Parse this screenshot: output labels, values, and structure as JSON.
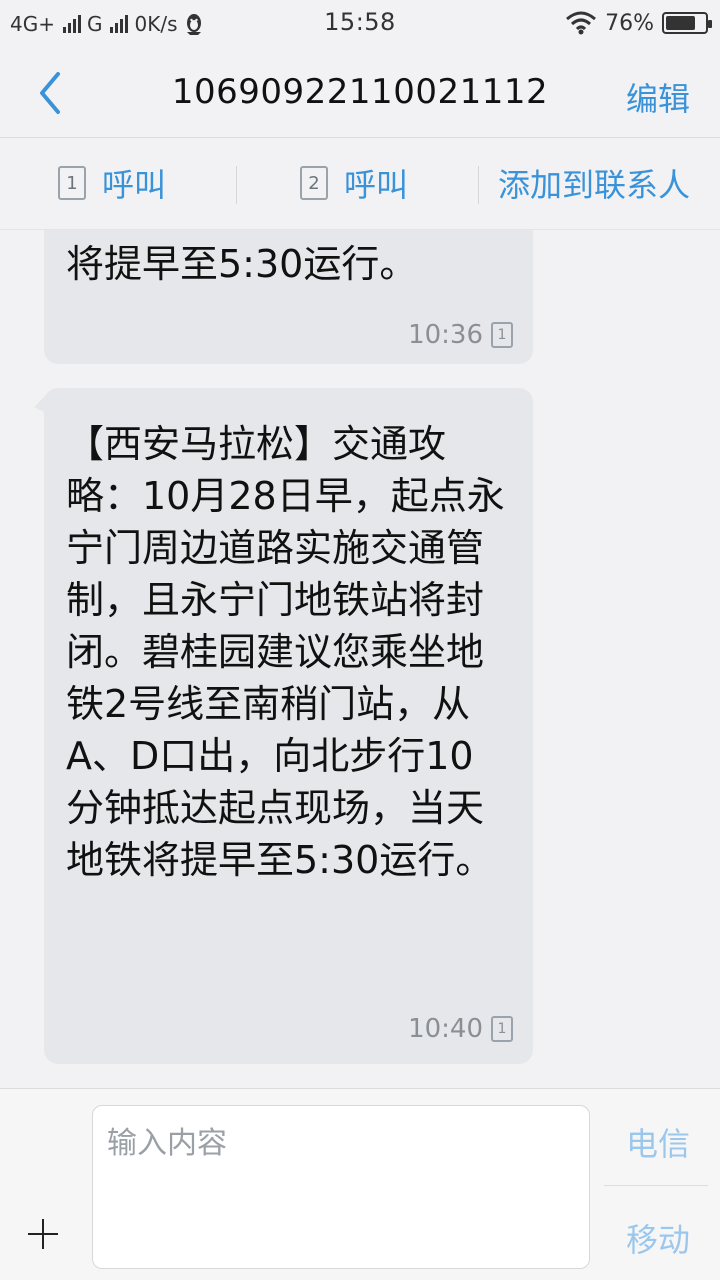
{
  "status_bar": {
    "left_network_1": "4G+",
    "left_network_2": "G",
    "left_speed": "0K/s",
    "time": "15:58",
    "battery_text": "76%",
    "battery_level": 0.76
  },
  "header": {
    "title": "10690922110021112",
    "edit_label": "编辑"
  },
  "actions": {
    "call_sim1_label": "呼叫",
    "call_sim2_label": "呼叫",
    "add_contact_label": "添加到联系人",
    "sim1_badge": "1",
    "sim2_badge": "2"
  },
  "messages": [
    {
      "text": "将提早至5:30运行。",
      "time": "10:36",
      "sim_badge": "1"
    },
    {
      "text": "【西安马拉松】交通攻略：10月28日早，起点永宁门周边道路实施交通管制，且永宁门地铁站将封闭。碧桂园建议您乘坐地铁2号线至南稍门站，从A、D口出，向北步行10分钟抵达起点现场，当天地铁将提早至5:30运行。",
      "time": "10:40",
      "sim_badge": "1"
    }
  ],
  "composer": {
    "placeholder": "输入内容",
    "send_option_1": "电信",
    "send_option_2": "移动"
  },
  "colors": {
    "accent": "#3a93d8",
    "bubble_bg": "#e6e7ea",
    "background": "#f2f2f4",
    "muted_send": "#9cc7ec"
  },
  "icons": {
    "back": "chevron-left-icon",
    "wifi": "wifi-icon",
    "battery": "battery-icon",
    "notification": "penguin-icon",
    "add": "plus-icon",
    "sim": "sim-card-icon"
  }
}
